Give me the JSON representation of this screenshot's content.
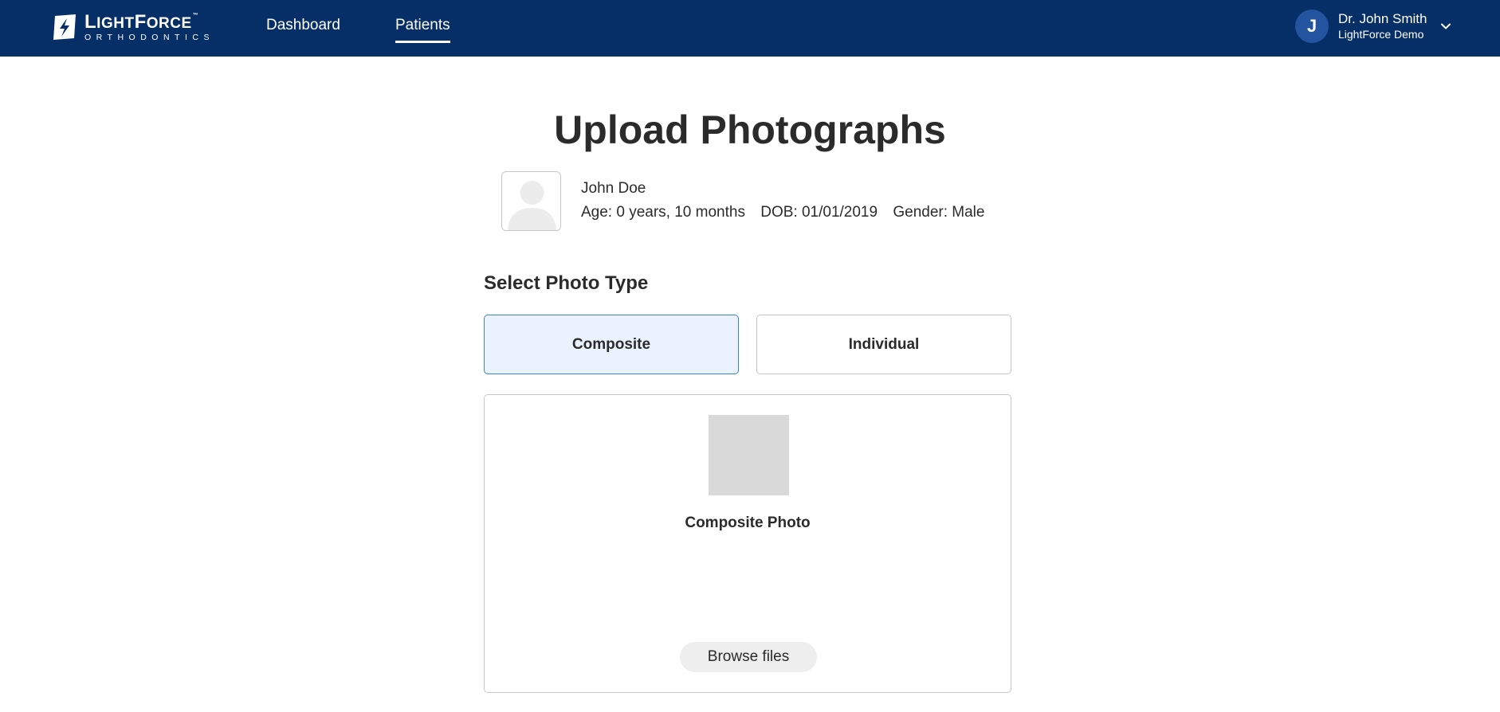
{
  "brand": {
    "name_big_l": "L",
    "name_rest_1": "IGHT",
    "name_big_f": "F",
    "name_rest_2": "ORCE",
    "trademark": "™",
    "subtitle": "ORTHODONTICS",
    "color": "#062f67"
  },
  "nav": {
    "items": [
      {
        "label": "Dashboard",
        "active": false
      },
      {
        "label": "Patients",
        "active": true
      }
    ]
  },
  "user": {
    "initial": "J",
    "name": "Dr. John Smith",
    "organization": "LightForce Demo"
  },
  "page": {
    "title": "Upload Photographs"
  },
  "patient": {
    "name": "John Doe",
    "age": "Age: 0 years, 10 months",
    "dob": "DOB: 01/01/2019",
    "gender": "Gender: Male"
  },
  "photo_type": {
    "label": "Select Photo Type",
    "options": [
      {
        "label": "Composite",
        "selected": true
      },
      {
        "label": "Individual",
        "selected": false
      }
    ],
    "selected_color": "#3d83d8"
  },
  "upload": {
    "slot_label": "Composite Photo",
    "browse_label": "Browse files"
  },
  "icons": {
    "logo": "lightforce-logo-icon",
    "avatar_placeholder": "person-silhouette-icon",
    "user_menu": "chevron-down-icon"
  }
}
